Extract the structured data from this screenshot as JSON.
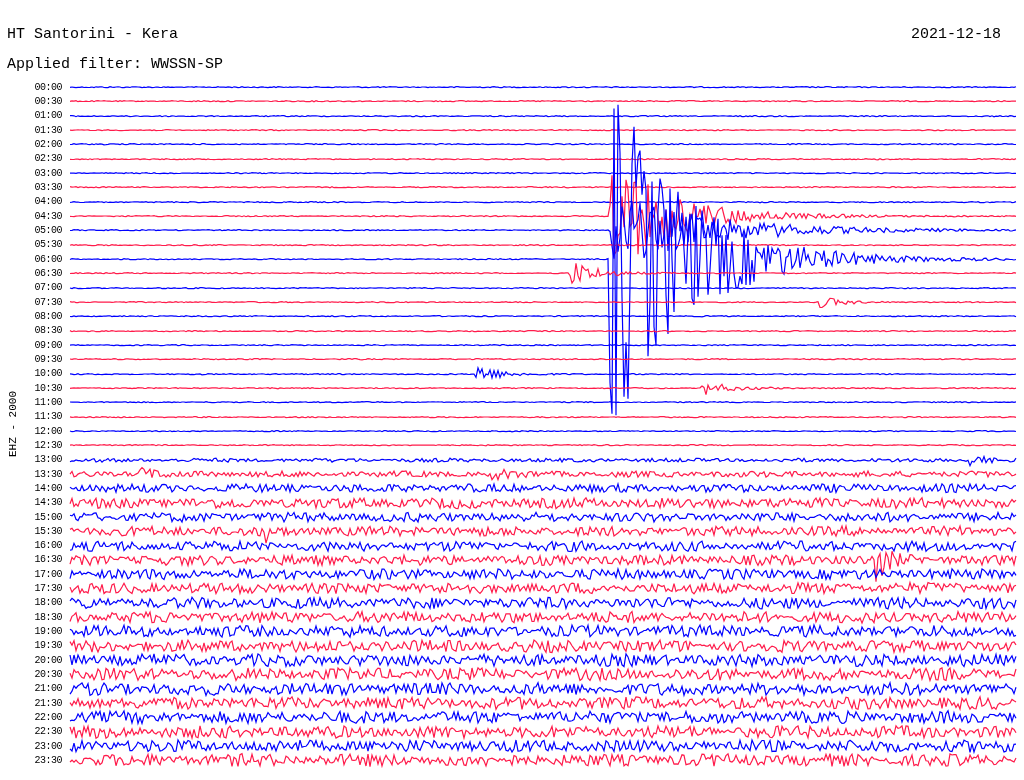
{
  "header": {
    "title": "HT Santorini - Kera",
    "date": "2021-12-18",
    "filter": "Applied filter: WWSSN-SP"
  },
  "channel_label": "EHZ - 2000",
  "rows": [
    {
      "time": "00:00",
      "color": "#0000ff"
    },
    {
      "time": "00:30",
      "color": "#ff1a4a"
    },
    {
      "time": "01:00",
      "color": "#0000ff"
    },
    {
      "time": "01:30",
      "color": "#ff1a4a"
    },
    {
      "time": "02:00",
      "color": "#0000ff"
    },
    {
      "time": "02:30",
      "color": "#ff1a4a"
    },
    {
      "time": "03:00",
      "color": "#0000ff"
    },
    {
      "time": "03:30",
      "color": "#ff1a4a"
    },
    {
      "time": "04:00",
      "color": "#0000ff"
    },
    {
      "time": "04:30",
      "color": "#ff1a4a"
    },
    {
      "time": "05:00",
      "color": "#0000ff"
    },
    {
      "time": "05:30",
      "color": "#ff1a4a"
    },
    {
      "time": "06:00",
      "color": "#0000ff"
    },
    {
      "time": "06:30",
      "color": "#ff1a4a"
    },
    {
      "time": "07:00",
      "color": "#0000ff"
    },
    {
      "time": "07:30",
      "color": "#ff1a4a"
    },
    {
      "time": "08:00",
      "color": "#0000ff"
    },
    {
      "time": "08:30",
      "color": "#ff1a4a"
    },
    {
      "time": "09:00",
      "color": "#0000ff"
    },
    {
      "time": "09:30",
      "color": "#ff1a4a"
    },
    {
      "time": "10:00",
      "color": "#0000ff"
    },
    {
      "time": "10:30",
      "color": "#ff1a4a"
    },
    {
      "time": "11:00",
      "color": "#0000ff"
    },
    {
      "time": "11:30",
      "color": "#ff1a4a"
    },
    {
      "time": "12:00",
      "color": "#0000ff"
    },
    {
      "time": "12:30",
      "color": "#ff1a4a"
    },
    {
      "time": "13:00",
      "color": "#0000ff"
    },
    {
      "time": "13:30",
      "color": "#ff1a4a"
    },
    {
      "time": "14:00",
      "color": "#0000ff"
    },
    {
      "time": "14:30",
      "color": "#ff1a4a"
    },
    {
      "time": "15:00",
      "color": "#0000ff"
    },
    {
      "time": "15:30",
      "color": "#ff1a4a"
    },
    {
      "time": "16:00",
      "color": "#0000ff"
    },
    {
      "time": "16:30",
      "color": "#ff1a4a"
    },
    {
      "time": "17:00",
      "color": "#0000ff"
    },
    {
      "time": "17:30",
      "color": "#ff1a4a"
    },
    {
      "time": "18:00",
      "color": "#0000ff"
    },
    {
      "time": "18:30",
      "color": "#ff1a4a"
    },
    {
      "time": "19:00",
      "color": "#0000ff"
    },
    {
      "time": "19:30",
      "color": "#ff1a4a"
    },
    {
      "time": "20:00",
      "color": "#0000ff"
    },
    {
      "time": "20:30",
      "color": "#ff1a4a"
    },
    {
      "time": "21:00",
      "color": "#0000ff"
    },
    {
      "time": "21:30",
      "color": "#ff1a4a"
    },
    {
      "time": "22:00",
      "color": "#0000ff"
    },
    {
      "time": "22:30",
      "color": "#ff1a4a"
    },
    {
      "time": "23:00",
      "color": "#0000ff"
    },
    {
      "time": "23:30",
      "color": "#ff1a4a"
    }
  ]
}
